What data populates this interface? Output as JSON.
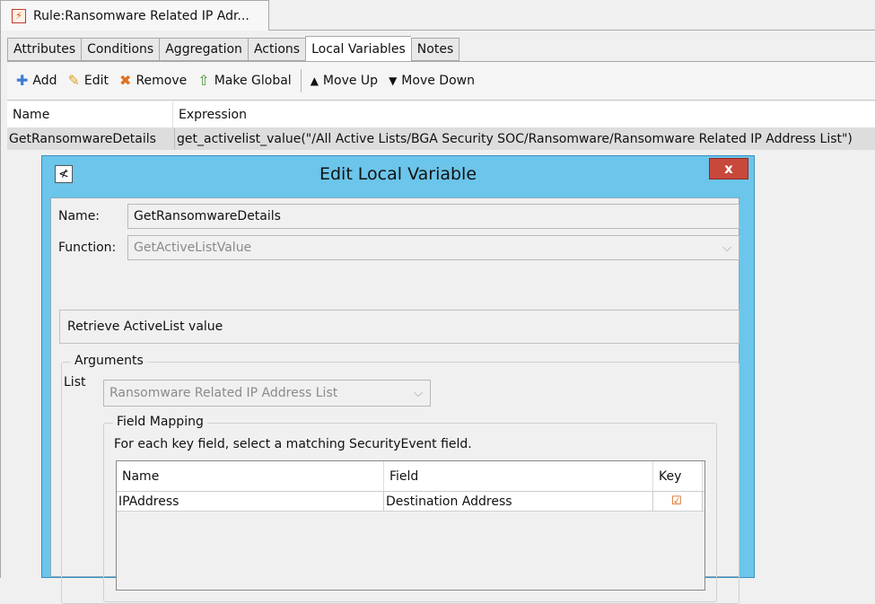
{
  "document_tab": {
    "title": "Rule:Ransomware Related IP Adr...",
    "icon": "rule-icon"
  },
  "tabs": [
    {
      "label": "Attributes"
    },
    {
      "label": "Conditions"
    },
    {
      "label": "Aggregation"
    },
    {
      "label": "Actions"
    },
    {
      "label": "Local Variables"
    },
    {
      "label": "Notes"
    }
  ],
  "active_tab": "Local Variables",
  "toolbar": {
    "add": "Add",
    "edit": "Edit",
    "remove": "Remove",
    "make_global": "Make Global",
    "move_up": "Move Up",
    "move_down": "Move Down"
  },
  "variables_table": {
    "columns": [
      "Name",
      "Expression"
    ],
    "rows": [
      {
        "name": "GetRansomwareDetails",
        "expression": "get_activelist_value(\"/All Active Lists/BGA Security SOC/Ransomware/Ransomware Related IP Address List\")"
      }
    ]
  },
  "dialog": {
    "title": "Edit Local Variable",
    "close_label": "x",
    "name_label": "Name:",
    "name_value": "GetRansomwareDetails",
    "function_label": "Function:",
    "function_value": "GetActiveListValue",
    "description": "Retrieve ActiveList value",
    "arguments_title": "Arguments",
    "list_label": "List",
    "list_value": "Ransomware Related IP Address List",
    "field_mapping_title": "Field Mapping",
    "field_mapping_hint": "For each key field, select a matching SecurityEvent field.",
    "mapping_columns": [
      "Name",
      "Field",
      "Key"
    ],
    "mapping_rows": [
      {
        "name": "IPAddress",
        "field": "Destination Address",
        "key": true
      }
    ]
  },
  "colors": {
    "dialog_frame": "#6cc5ea",
    "close_button": "#c9483c",
    "selected_row": "#dddddd"
  }
}
